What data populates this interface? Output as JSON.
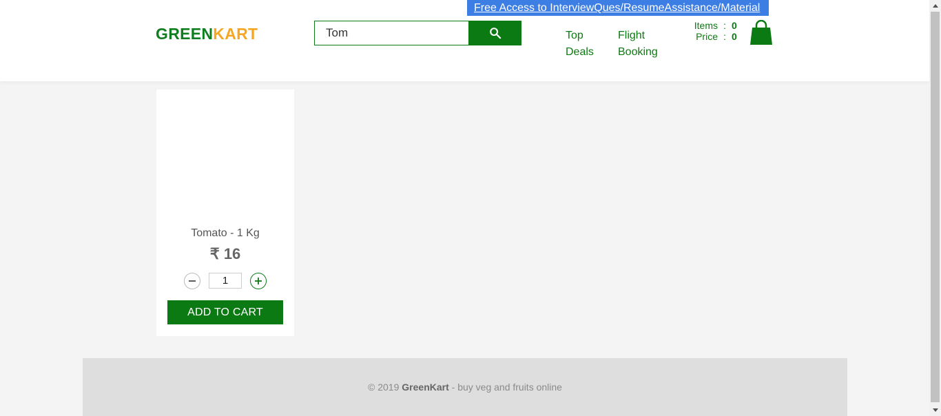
{
  "promo": {
    "text": "Free Access to InterviewQues/ResumeAssistance/Material"
  },
  "brand": {
    "part1": "GREEN",
    "part2": "KART",
    "color1": "#0f7e1e",
    "color2": "#f5a623"
  },
  "search": {
    "value": "Tom",
    "button_icon": "search-icon"
  },
  "nav": [
    {
      "line1": "Top",
      "line2": "Deals"
    },
    {
      "line1": "Flight",
      "line2": "Booking"
    }
  ],
  "cart": {
    "items_label": "Items",
    "items_value": "0",
    "price_label": "Price",
    "price_value": "0",
    "icon": "shopping-bag-icon"
  },
  "product": {
    "name": "Tomato - 1 Kg",
    "price": "₹ 16",
    "quantity": "1",
    "add_label": "ADD TO CART"
  },
  "footer": {
    "prefix": "© 2019 ",
    "brand": "GreenKart",
    "suffix": " - buy veg and fruits online"
  },
  "colors": {
    "accent": "#0c7a12",
    "promo_bg": "#3c7ee4",
    "page_bg": "#f4f4f4"
  }
}
